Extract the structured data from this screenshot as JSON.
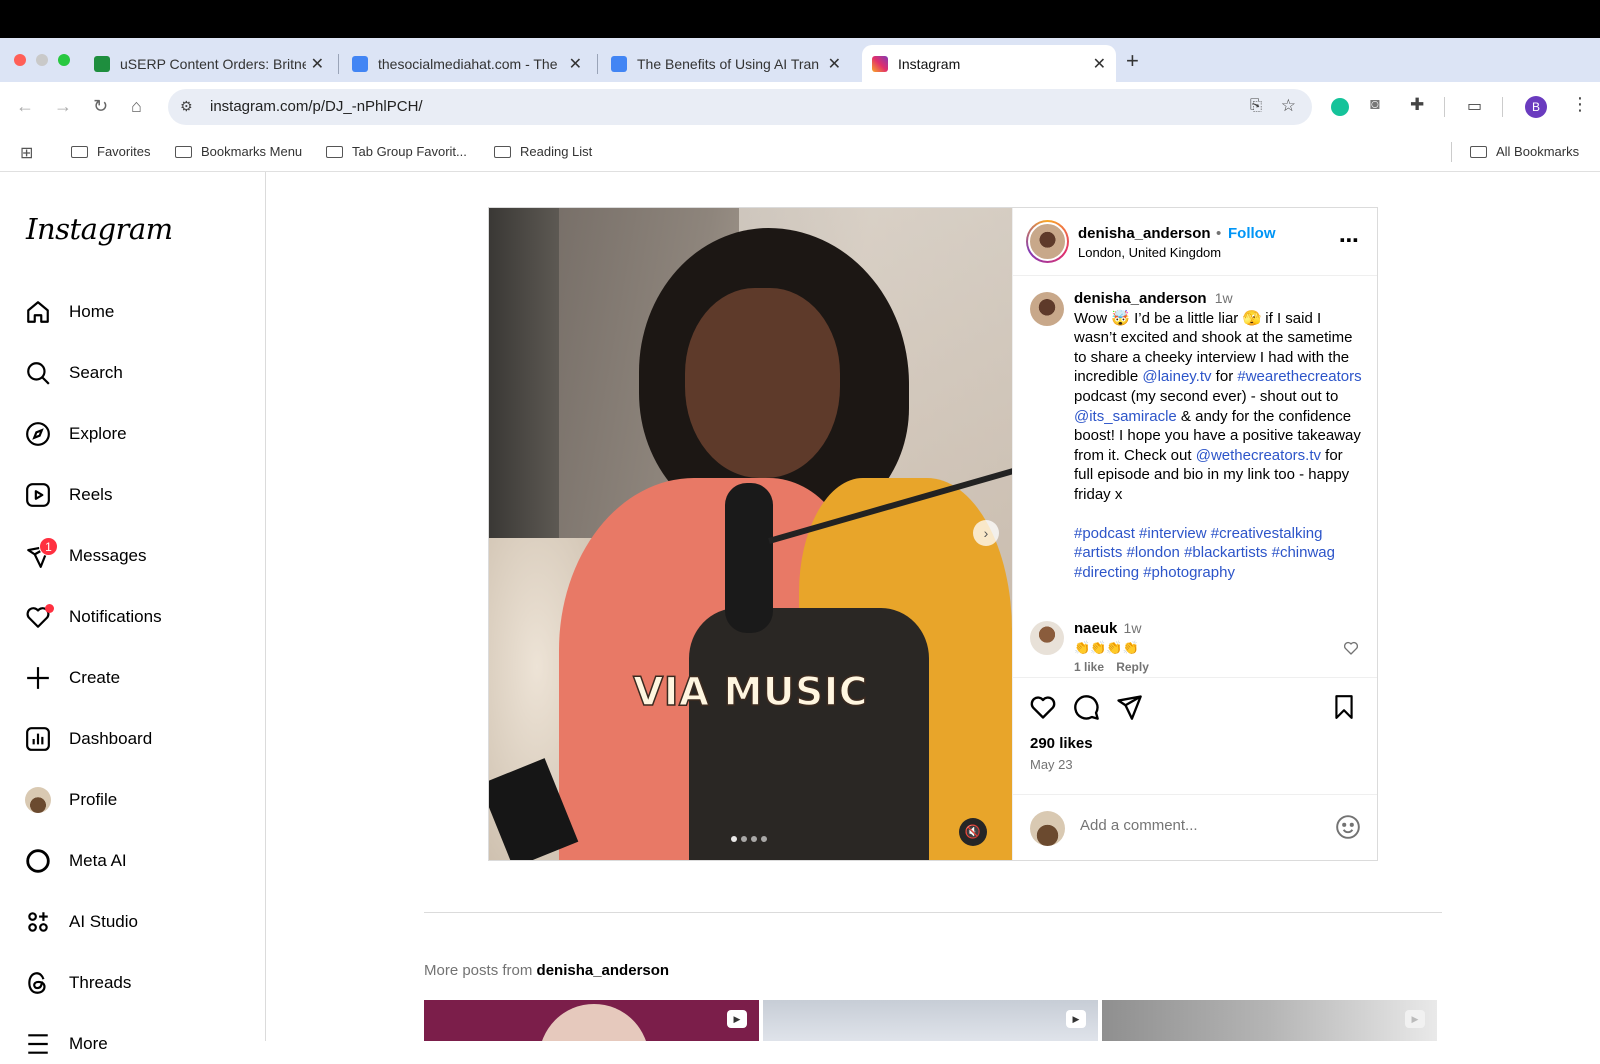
{
  "browser": {
    "tabs": [
      {
        "title": "uSERP Content Orders: Britney",
        "favicon": "sheets-icon",
        "color": "#1e8e3e"
      },
      {
        "title": "thesocialmediahat.com - The",
        "favicon": "docs-icon",
        "color": "#4285f4"
      },
      {
        "title": "The Benefits of Using AI Tran",
        "favicon": "docs-icon",
        "color": "#4285f4"
      },
      {
        "title": "Instagram",
        "favicon": "instagram-icon",
        "color": "#e1306c"
      }
    ],
    "url": "instagram.com/p/DJ_-nPhlPCH/",
    "profile_initial": "B",
    "bookmarks": [
      "Favorites",
      "Bookmarks Menu",
      "Tab Group Favorit...",
      "Reading List"
    ],
    "all_bookmarks": "All Bookmarks"
  },
  "sidebar": {
    "logo": "Instagram",
    "items": [
      {
        "label": "Home",
        "icon": "home-icon"
      },
      {
        "label": "Search",
        "icon": "search-icon"
      },
      {
        "label": "Explore",
        "icon": "compass-icon"
      },
      {
        "label": "Reels",
        "icon": "reels-icon"
      },
      {
        "label": "Messages",
        "icon": "messenger-icon",
        "badge": "1"
      },
      {
        "label": "Notifications",
        "icon": "heart-icon"
      },
      {
        "label": "Create",
        "icon": "plus-icon"
      },
      {
        "label": "Dashboard",
        "icon": "chart-icon"
      },
      {
        "label": "Profile",
        "icon": "avatar-icon"
      },
      {
        "label": "Meta AI",
        "icon": "meta-ai-icon"
      },
      {
        "label": "AI Studio",
        "icon": "ai-studio-icon"
      },
      {
        "label": "Threads",
        "icon": "threads-icon"
      },
      {
        "label": "More",
        "icon": "menu-icon"
      }
    ]
  },
  "post": {
    "username": "denisha_anderson",
    "follow": "Follow",
    "location": "London, United Kingdom",
    "video_caption": "VIA MUSIC",
    "caption": {
      "username": "denisha_anderson",
      "time": "1w",
      "t1": "Wow 🤯 I’d be a little liar 🫣 if I said I wasn’t excited and shook at the sametime to share a cheeky interview I had with the incredible ",
      "m1": "@lainey.tv",
      "t2": " for ",
      "h1": "#wearethecreators",
      "t3": " podcast (my second ever) - shout out to ",
      "m2": "@its_samiracle",
      "t4": " & andy for the confidence boost! I hope you have a positive takeaway from it. Check out ",
      "m3": "@wethecreators.tv",
      "t5": " for full episode and bio in my link too - happy friday x",
      "hashtags": "#podcast #interview #creativestalking #artists #london #blackartists #chinwag #directing #photography"
    },
    "comment": {
      "username": "naeuk",
      "time": "1w",
      "text": "👏👏👏👏",
      "likes": "1 like",
      "reply": "Reply"
    },
    "likes": "290 likes",
    "date": "May 23",
    "comment_placeholder": "Add a comment..."
  },
  "more_posts": {
    "prefix": "More posts from ",
    "username": "denisha_anderson"
  }
}
